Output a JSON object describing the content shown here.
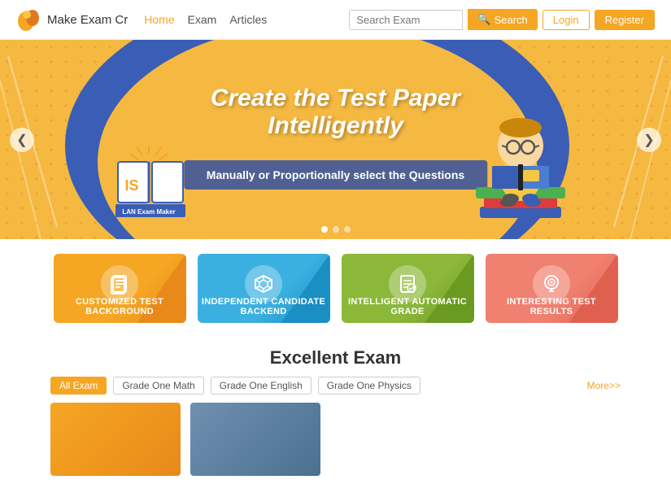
{
  "navbar": {
    "logo_text": "Make Exam Cr",
    "links": [
      {
        "label": "Home",
        "active": true
      },
      {
        "label": "Exam",
        "active": false
      },
      {
        "label": "Articles",
        "active": false
      }
    ],
    "search_placeholder": "Search Exam",
    "search_label": "Search",
    "login_label": "Login",
    "register_label": "Register"
  },
  "hero": {
    "title_line1": "Create the Test Paper",
    "title_line2": "Intelligently",
    "subtitle": "Manually or Proportionally select the Questions",
    "prev_label": "❮",
    "next_label": "❯"
  },
  "features": [
    {
      "label": "Customized Test Background",
      "icon": "📋",
      "color": "orange"
    },
    {
      "label": "Independent Candidate Backend",
      "icon": "📦",
      "color": "blue"
    },
    {
      "label": "Intelligent Automatic Grade",
      "icon": "📄",
      "color": "green"
    },
    {
      "label": "Interesting Test Results",
      "icon": "🧠",
      "color": "salmon"
    }
  ],
  "excellent_section": {
    "title": "Excellent Exam",
    "tabs": [
      "All Exam",
      "Grade One Math",
      "Grade One English",
      "Grade One Physics"
    ],
    "more_label": "More>>"
  }
}
